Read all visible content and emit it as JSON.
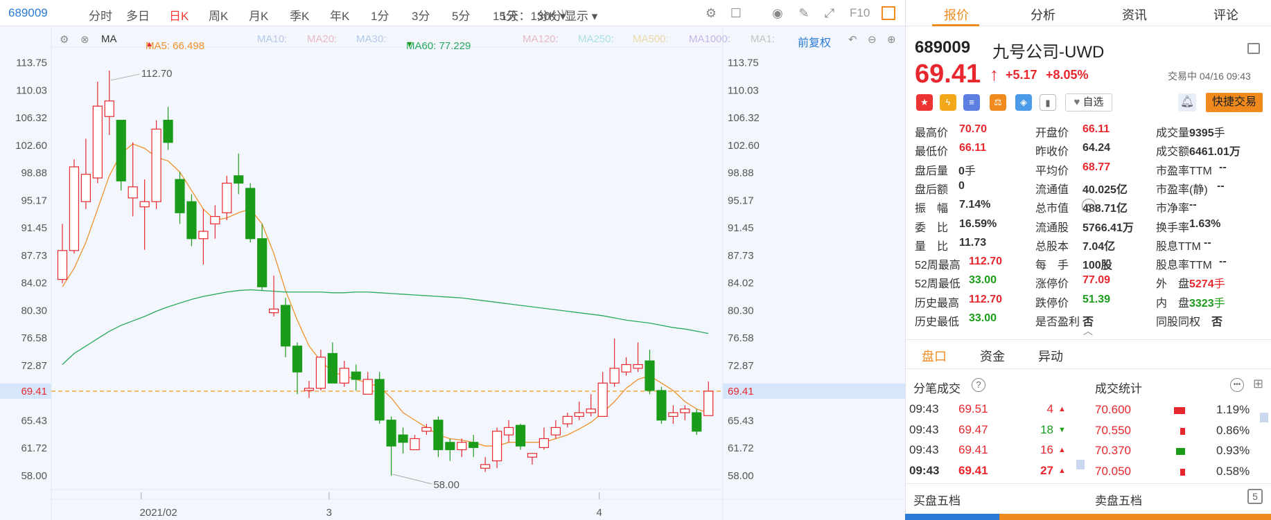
{
  "toolbar": {
    "code": "689009",
    "items": [
      "分时",
      "多日",
      "日K",
      "周K",
      "月K",
      "季K",
      "年K",
      "1分",
      "3分",
      "5分",
      "15分",
      "30分"
    ],
    "selected": "日K",
    "range": "1天：1分K",
    "display": "显示",
    "f10": "F10"
  },
  "ma_bar": {
    "ma": "MA",
    "ma5": "MA5: 66.498",
    "ma10": "MA10:",
    "ma20": "MA20:",
    "ma30": "MA30:",
    "ma60": "MA60: 77.229",
    "ma120": "MA120:",
    "ma250": "MA250:",
    "ma500": "MA500:",
    "ma1000": "MA1000:",
    "ma1x": "MA1:",
    "adjust": "前复权"
  },
  "chart_data": {
    "type": "candlestick",
    "ylim": [
      56.5,
      115.5
    ],
    "y_ticks": [
      "113.75",
      "110.03",
      "106.32",
      "102.60",
      "98.88",
      "95.17",
      "91.45",
      "87.73",
      "84.02",
      "80.30",
      "76.58",
      "72.87",
      "69.41",
      "65.43",
      "61.72",
      "58.00"
    ],
    "x_labels": [
      {
        "label": "2021/02",
        "index": 7
      },
      {
        "label": "3",
        "index": 23
      },
      {
        "label": "4",
        "index": 46
      }
    ],
    "current_price": 69.41,
    "annotations": {
      "high": "112.70",
      "low": "58.00"
    },
    "candles": [
      [
        84.5,
        88.4,
        92.0,
        84.0
      ],
      [
        88.4,
        99.7,
        100.7,
        88.0
      ],
      [
        95.0,
        98.7,
        103.5,
        94.0
      ],
      [
        98.2,
        107.9,
        111.2,
        97.5
      ],
      [
        106.5,
        108.6,
        112.7,
        104.0
      ],
      [
        106.0,
        97.8,
        106.0,
        96.5
      ],
      [
        95.5,
        97.0,
        103.0,
        93.0
      ],
      [
        94.3,
        95.0,
        98.0,
        88.5
      ],
      [
        95.0,
        104.8,
        106.0,
        94.0
      ],
      [
        106.0,
        103.0,
        107.8,
        102.0
      ],
      [
        98.0,
        93.5,
        99.0,
        92.0
      ],
      [
        95.0,
        90.0,
        96.0,
        89.0
      ],
      [
        90.0,
        91.0,
        94.0,
        86.5
      ],
      [
        92.0,
        93.0,
        94.5,
        90.0
      ],
      [
        93.5,
        97.5,
        98.5,
        92.5
      ],
      [
        98.5,
        97.5,
        101.5,
        96.0
      ],
      [
        96.8,
        90.0,
        97.5,
        89.5
      ],
      [
        90.0,
        83.5,
        92.0,
        83.0
      ],
      [
        80.0,
        80.5,
        85.0,
        79.5
      ],
      [
        81.0,
        75.5,
        82.0,
        74.0
      ],
      [
        75.5,
        72.0,
        76.0,
        69.0
      ],
      [
        69.5,
        69.8,
        70.8,
        68.5
      ],
      [
        69.8,
        74.0,
        75.0,
        69.5
      ],
      [
        74.5,
        70.5,
        76.0,
        70.5
      ],
      [
        70.5,
        72.5,
        73.5,
        70.0
      ],
      [
        72.0,
        71.0,
        73.0,
        69.5
      ],
      [
        69.0,
        71.0,
        72.0,
        69.0
      ],
      [
        71.0,
        65.5,
        72.0,
        65.0
      ],
      [
        65.5,
        62.0,
        66.0,
        58.0
      ],
      [
        63.5,
        62.5,
        64.5,
        61.0
      ],
      [
        61.5,
        63.0,
        63.5,
        61.5
      ],
      [
        64.0,
        64.5,
        65.0,
        63.5
      ],
      [
        65.5,
        61.5,
        66.0,
        60.5
      ],
      [
        62.5,
        61.5,
        63.0,
        60.0
      ],
      [
        61.5,
        62.5,
        63.0,
        60.5
      ],
      [
        62.5,
        61.8,
        63.5,
        60.5
      ],
      [
        59.0,
        59.5,
        60.5,
        58.5
      ],
      [
        60.0,
        64.0,
        64.5,
        59.0
      ],
      [
        63.5,
        64.5,
        65.5,
        62.5
      ],
      [
        64.8,
        62.0,
        65.0,
        61.5
      ],
      [
        60.5,
        61.0,
        61.0,
        59.5
      ],
      [
        61.8,
        63.0,
        64.5,
        61.5
      ],
      [
        63.5,
        64.5,
        65.5,
        63.0
      ],
      [
        65.0,
        66.0,
        66.5,
        64.5
      ],
      [
        66.0,
        66.5,
        68.0,
        65.5
      ],
      [
        66.5,
        67.0,
        69.0,
        66.0
      ],
      [
        66.0,
        70.5,
        72.0,
        66.0
      ],
      [
        70.5,
        72.5,
        76.5,
        70.0
      ],
      [
        72.0,
        73.0,
        74.0,
        71.5
      ],
      [
        72.5,
        73.0,
        76.0,
        72.0
      ],
      [
        73.5,
        69.5,
        75.0,
        69.0
      ],
      [
        69.5,
        65.5,
        70.0,
        65.0
      ],
      [
        66.0,
        66.5,
        67.5,
        65.0
      ],
      [
        66.5,
        67.0,
        67.5,
        65.5
      ],
      [
        66.5,
        64.0,
        67.0,
        63.5
      ],
      [
        66.11,
        69.41,
        70.7,
        66.11
      ]
    ],
    "series": [
      {
        "name": "MA5",
        "color": "#f0902a",
        "values": [
          83.5,
          86.0,
          89.5,
          94.0,
          98.5,
          101.5,
          102.8,
          102.2,
          101.0,
          100.5,
          99.0,
          96.5,
          94.0,
          92.5,
          92.8,
          93.5,
          94.0,
          92.0,
          88.0,
          83.0,
          79.0,
          75.5,
          73.5,
          72.0,
          71.5,
          71.0,
          70.5,
          70.0,
          68.5,
          66.5,
          65.5,
          64.5,
          63.5,
          63.0,
          62.8,
          62.5,
          62.0,
          62.0,
          62.5,
          62.5,
          62.5,
          62.5,
          63.0,
          63.5,
          64.3,
          65.2,
          66.5,
          68.0,
          69.8,
          71.0,
          71.5,
          70.5,
          69.5,
          68.0,
          67.0,
          66.5
        ]
      },
      {
        "name": "MA60",
        "color": "#28a85c",
        "values": [
          73.0,
          74.5,
          75.5,
          76.5,
          77.5,
          78.3,
          78.9,
          79.5,
          80.2,
          80.8,
          81.3,
          81.8,
          82.2,
          82.5,
          82.8,
          83.0,
          83.1,
          83.0,
          82.9,
          82.8,
          82.8,
          82.8,
          82.8,
          82.7,
          82.7,
          82.8,
          82.8,
          82.7,
          82.6,
          82.5,
          82.4,
          82.3,
          82.2,
          82.1,
          82.0,
          81.8,
          81.6,
          81.4,
          81.2,
          81.0,
          80.8,
          80.6,
          80.4,
          80.2,
          80.0,
          79.8,
          79.6,
          79.3,
          79.0,
          78.8,
          78.6,
          78.3,
          78.0,
          77.8,
          77.5,
          77.2
        ]
      }
    ]
  },
  "quote": {
    "code": "689009",
    "name": "九号公司-UWD",
    "price": "69.41",
    "arrow": "↑",
    "change": "+5.17",
    "pct": "+8.05%",
    "status": "交易中 04/16 09:43",
    "watch": "自选",
    "quick_trade": "快捷交易",
    "fields": [
      [
        {
          "l": "最高价",
          "v": "70.70",
          "c": "red"
        },
        {
          "l": "开盘价",
          "v": "66.11",
          "c": "red"
        },
        {
          "l": "成交量",
          "v": "9395",
          "u": "手",
          "c": "blk"
        }
      ],
      [
        {
          "l": "最低价",
          "v": "66.11",
          "c": "red"
        },
        {
          "l": "昨收价",
          "v": "64.24",
          "c": "blk"
        },
        {
          "l": "成交额",
          "v": "6461.01万",
          "c": "blk"
        }
      ],
      [
        {
          "l": "盘后量",
          "v": "0",
          "u": "手",
          "c": "blk"
        },
        {
          "l": "平均价",
          "v": "68.77",
          "c": "red"
        },
        {
          "l": "市盈率TTM",
          "v": "--",
          "c": "blk"
        }
      ],
      [
        {
          "l": "盘后额",
          "v": "0",
          "c": "blk"
        },
        {
          "l": "流通值",
          "v": "40.025亿",
          "c": "blk"
        },
        {
          "l": "市盈率(静)",
          "v": "--",
          "c": "blk"
        }
      ],
      [
        {
          "l": "振　幅",
          "v": "7.14%",
          "c": "blk"
        },
        {
          "l": "总市值",
          "v": "488.71亿",
          "c": "blk"
        },
        {
          "l": "市净率",
          "v": "--",
          "c": "blk"
        }
      ],
      [
        {
          "l": "委　比",
          "v": "16.59%",
          "c": "blk"
        },
        {
          "l": "流通股",
          "v": "5766.41万",
          "c": "blk"
        },
        {
          "l": "换手率",
          "v": "1.63%",
          "c": "blk"
        }
      ],
      [
        {
          "l": "量　比",
          "v": "11.73",
          "c": "blk"
        },
        {
          "l": "总股本",
          "v": "7.04亿",
          "c": "blk"
        },
        {
          "l": "股息TTM",
          "v": "--",
          "c": "blk"
        }
      ],
      [
        {
          "l": "52周最高",
          "v": "112.70",
          "c": "red"
        },
        {
          "l": "每　手",
          "v": "100股",
          "c": "blk"
        },
        {
          "l": "股息率TTM",
          "v": "--",
          "c": "blk"
        }
      ],
      [
        {
          "l": "52周最低",
          "v": "33.00",
          "c": "grn"
        },
        {
          "l": "涨停价",
          "v": "77.09",
          "c": "red"
        },
        {
          "l": "外　盘",
          "v": "5274",
          "u": "手",
          "c": "red"
        }
      ],
      [
        {
          "l": "历史最高",
          "v": "112.70",
          "c": "red"
        },
        {
          "l": "跌停价",
          "v": "51.39",
          "c": "grn"
        },
        {
          "l": "内　盘",
          "v": "3323",
          "u": "手",
          "c": "grn"
        }
      ],
      [
        {
          "l": "历史最低",
          "v": "33.00",
          "c": "grn"
        },
        {
          "l": "是否盈利",
          "v": "否",
          "c": "blk"
        },
        {
          "l": "同股同权",
          "v": "否",
          "c": "blk"
        }
      ]
    ]
  },
  "tabs": [
    "报价",
    "分析",
    "资讯",
    "评论"
  ],
  "subtabs": [
    "盘口",
    "资金",
    "异动"
  ],
  "ticks": {
    "title": "分笔成交",
    "rows": [
      {
        "t": "09:43",
        "p": "69.51",
        "v": "4",
        "d": "up"
      },
      {
        "t": "09:43",
        "p": "69.47",
        "v": "18",
        "d": "down"
      },
      {
        "t": "09:43",
        "p": "69.41",
        "v": "16",
        "d": "up"
      },
      {
        "t": "09:43",
        "p": "69.41",
        "v": "27",
        "d": "up"
      }
    ]
  },
  "stats": {
    "title": "成交统计",
    "rows": [
      {
        "p": "70.600",
        "pct": "1.19%",
        "color": "#e8262d",
        "w": 0.9
      },
      {
        "p": "70.550",
        "pct": "0.86%",
        "color": "#e8262d",
        "w": 0.4
      },
      {
        "p": "70.370",
        "pct": "0.93%",
        "color": "#1a9c1a",
        "w": 0.7
      },
      {
        "p": "70.050",
        "pct": "0.58%",
        "color": "#e8262d",
        "w": 0.4
      }
    ]
  },
  "book": {
    "buy": "买盘五档",
    "sell": "卖盘五档"
  }
}
